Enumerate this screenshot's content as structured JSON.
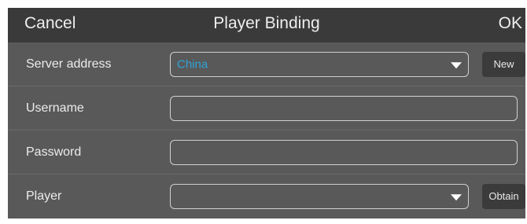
{
  "header": {
    "cancel_label": "Cancel",
    "title": "Player Binding",
    "ok_label": "OK"
  },
  "form": {
    "server_address": {
      "label": "Server address",
      "value": "China",
      "button_label": "New"
    },
    "username": {
      "label": "Username",
      "value": ""
    },
    "password": {
      "label": "Password",
      "value": ""
    },
    "player": {
      "label": "Player",
      "value": "",
      "button_label": "Obtain"
    }
  },
  "colors": {
    "header_bg": "#3a3a3a",
    "body_bg": "#595959",
    "accent_value": "#2fa3d8",
    "button_bg": "#3b3b3b"
  },
  "icons": {
    "dropdown": "caret-down-icon"
  }
}
